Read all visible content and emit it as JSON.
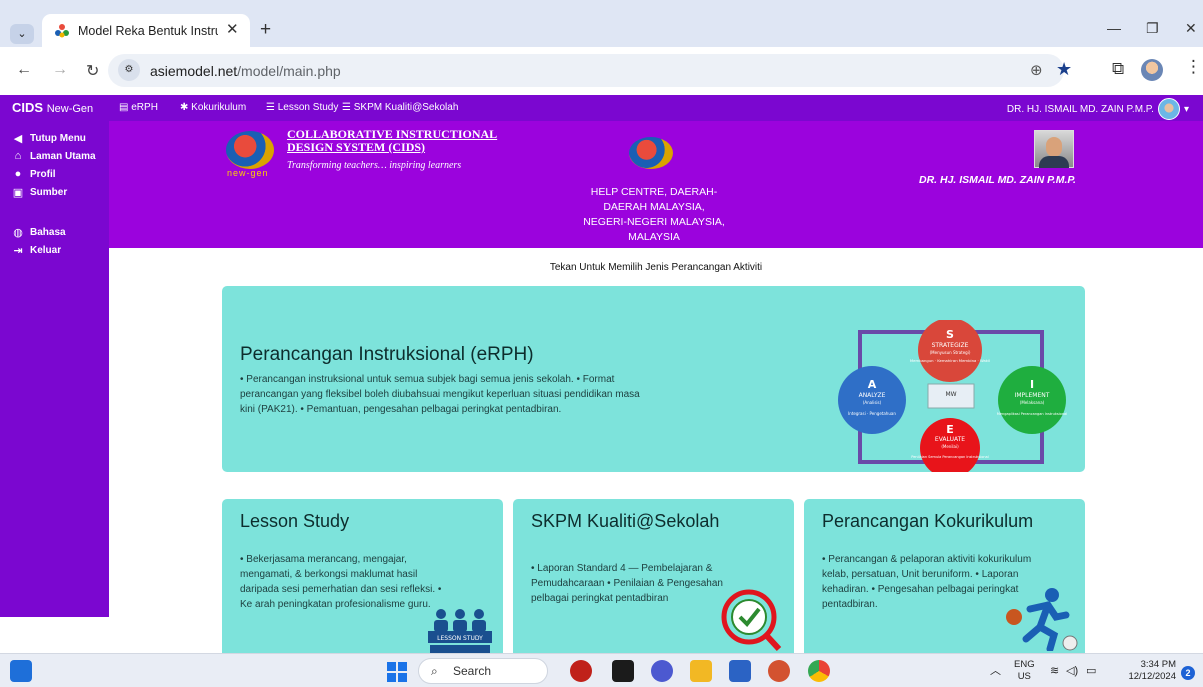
{
  "browser": {
    "tab_title": "Model Reka Bentuk Instruksiona",
    "new_tab": "+",
    "url_host": "asiemodel.net",
    "url_path": "/model/main.php"
  },
  "topnav": {
    "brand": "CIDS",
    "brand_sub": "New-Gen",
    "items": [
      {
        "label": "eRPH",
        "icon": "document-icon"
      },
      {
        "label": "Kokurikulum",
        "icon": "pin-icon"
      },
      {
        "label": "Lesson Study",
        "icon": "list-icon"
      },
      {
        "label": "SKPM Kualiti@Sekolah",
        "icon": "list-icon"
      }
    ],
    "user": "DR. HJ. ISMAIL MD. ZAIN P.M.P."
  },
  "sidebar": {
    "items": [
      {
        "label": "Tutup Menu",
        "icon": "chevron-left-icon"
      },
      {
        "label": "Laman Utama",
        "icon": "home-icon"
      },
      {
        "label": "Profil",
        "icon": "user-icon"
      },
      {
        "label": "Sumber",
        "icon": "image-icon"
      },
      {
        "label": "Bahasa",
        "icon": "globe-icon"
      },
      {
        "label": "Keluar",
        "icon": "logout-icon"
      }
    ]
  },
  "banner": {
    "title_line1": "COLLABORATIVE INSTRUCTIONAL",
    "title_line2": "DESIGN SYSTEM (CIDS)",
    "tagline": "Transforming teachers… inspiring learners",
    "newgen": "new-gen",
    "help_lines": [
      "HELP CENTRE, DAERAH-",
      "DAERAH MALAYSIA,",
      "NEGERI-NEGERI MALAYSIA,",
      "MALAYSIA"
    ],
    "person_name": "DR. HJ. ISMAIL MD. ZAIN P.M.P."
  },
  "main": {
    "instruction": "Tekan Untuk Memilih Jenis Perancangan Aktiviti",
    "cards": [
      {
        "title": "Perancangan Instruksional (eRPH)",
        "desc": "• Perancangan instruksional untuk semua subjek bagi semua jenis sekolah. • Format perancangan yang fleksibel boleh diubahsuai mengikut keperluan situasi pendidikan masa kini (PAK21). • Pemantuan, pengesahan pelbagai peringkat pentadbiran."
      },
      {
        "title": "Lesson Study",
        "desc": "• Bekerjasama merancang, mengajar, mengamati, & berkongsi maklumat hasil daripada sesi pemerhatian dan sesi refleksi. • Ke arah peningkatan profesionalisme guru.",
        "badge": "LESSON STUDY"
      },
      {
        "title": "SKPM Kualiti@Sekolah",
        "desc": "• Laporan Standard 4 — Pembelajaran & Pemudahcaraan • Penilaian & Pengesahan pelbagai peringkat pentadbiran"
      },
      {
        "title": "Perancangan Kokurikulum",
        "desc": "• Perancangan & pelaporan aktiviti kokurikulum kelab, persatuan, Unit beruniform. • Laporan kehadiran. • Pengesahan pelbagai peringkat pentadbiran."
      }
    ],
    "asie": {
      "s_letter": "S",
      "s_title": "STRATEGIZE",
      "s_sub": "(Menyusun Strategi)",
      "s_text": "Membangun · Kemahiran Membina · Wakil",
      "a_letter": "A",
      "a_title": "ANALYZE",
      "a_sub": "(Analisis)",
      "a_text": "Integrasi · Pengetahuan",
      "i_letter": "I",
      "i_title": "IMPLEMENT",
      "i_sub": "(Melaksana)",
      "i_text": "Mengaplikasi Perancangan Instruksional",
      "e_letter": "E",
      "e_title": "EVALUATE",
      "e_sub": "(Menilai)",
      "e_text": "Penilaian Semula Perancangan Instruksional",
      "center": "MW"
    }
  },
  "taskbar": {
    "search": "Search",
    "lang_top": "ENG",
    "lang_bottom": "US",
    "time": "3:34 PM",
    "date": "12/12/2024",
    "notifications": "2"
  },
  "colors": {
    "purple_nav": "#7b07d0",
    "purple_banner": "#9b03dd",
    "card_teal": "#7de3db"
  }
}
